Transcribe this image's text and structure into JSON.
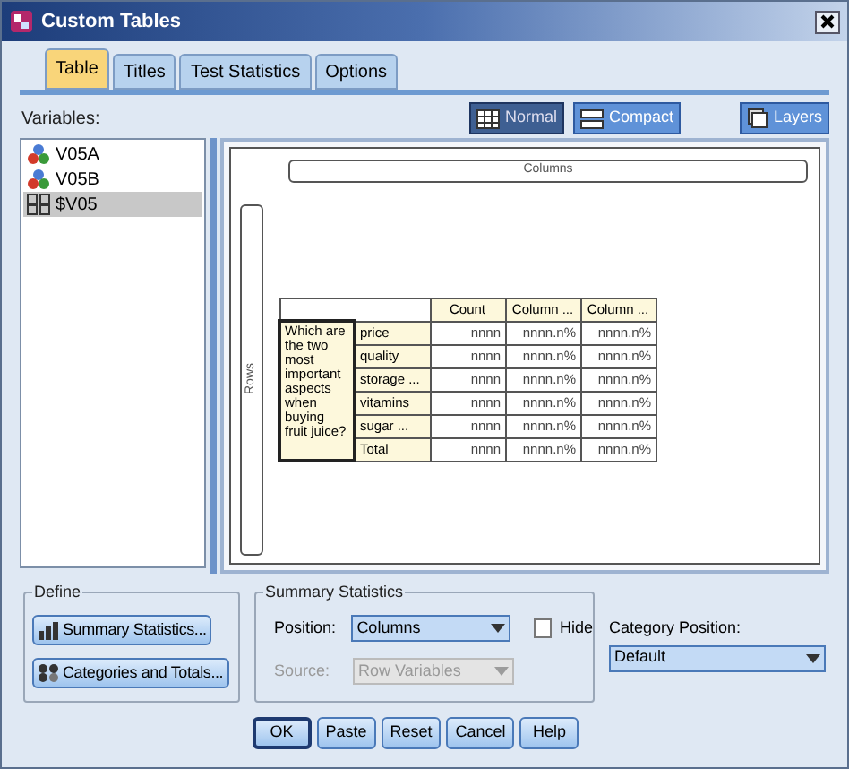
{
  "window": {
    "title": "Custom Tables"
  },
  "tabs": [
    {
      "label": "Table",
      "selected": true
    },
    {
      "label": "Titles",
      "selected": false
    },
    {
      "label": "Test Statistics",
      "selected": false
    },
    {
      "label": "Options",
      "selected": false
    }
  ],
  "variables_label": "Variables:",
  "view_buttons": [
    {
      "label": "Normal",
      "kind": "normal",
      "selected": true
    },
    {
      "label": "Compact",
      "kind": "compact",
      "selected": false
    }
  ],
  "layers_button": "Layers",
  "variables": [
    {
      "name": "V05A",
      "kind": "nominal",
      "selected": false
    },
    {
      "name": "V05B",
      "kind": "nominal",
      "selected": false
    },
    {
      "name": "$V05",
      "kind": "set",
      "selected": true
    }
  ],
  "canvas": {
    "columns_label": "Columns",
    "rows_label": "Rows",
    "table": {
      "header": [
        "Count",
        "Column ...",
        "Column ..."
      ],
      "row_variable": "Which are the two most important aspects when buying fruit juice?",
      "rows": [
        {
          "label": "price",
          "cells": [
            "nnnn",
            "nnnn.n%",
            "nnnn.n%"
          ]
        },
        {
          "label": "quality",
          "cells": [
            "nnnn",
            "nnnn.n%",
            "nnnn.n%"
          ]
        },
        {
          "label": "storage ...",
          "cells": [
            "nnnn",
            "nnnn.n%",
            "nnnn.n%"
          ]
        },
        {
          "label": "vitamins",
          "cells": [
            "nnnn",
            "nnnn.n%",
            "nnnn.n%"
          ]
        },
        {
          "label": "sugar ...",
          "cells": [
            "nnnn",
            "nnnn.n%",
            "nnnn.n%"
          ]
        },
        {
          "label": "Total",
          "cells": [
            "nnnn",
            "nnnn.n%",
            "nnnn.n%"
          ]
        }
      ]
    }
  },
  "define": {
    "title": "Define",
    "buttons": [
      {
        "label": "Summary Statistics...",
        "kind": "stats"
      },
      {
        "label": "Categories and Totals...",
        "kind": "categories"
      }
    ]
  },
  "summary_statistics": {
    "title": "Summary Statistics",
    "position_label": "Position:",
    "position_value": "Columns",
    "hide_label": "Hide",
    "hide_checked": false,
    "source_label": "Source:",
    "source_value": "Row Variables",
    "source_disabled": true
  },
  "category_position": {
    "label": "Category Position:",
    "value": "Default"
  },
  "buttons": [
    "OK",
    "Paste",
    "Reset",
    "Cancel",
    "Help"
  ]
}
